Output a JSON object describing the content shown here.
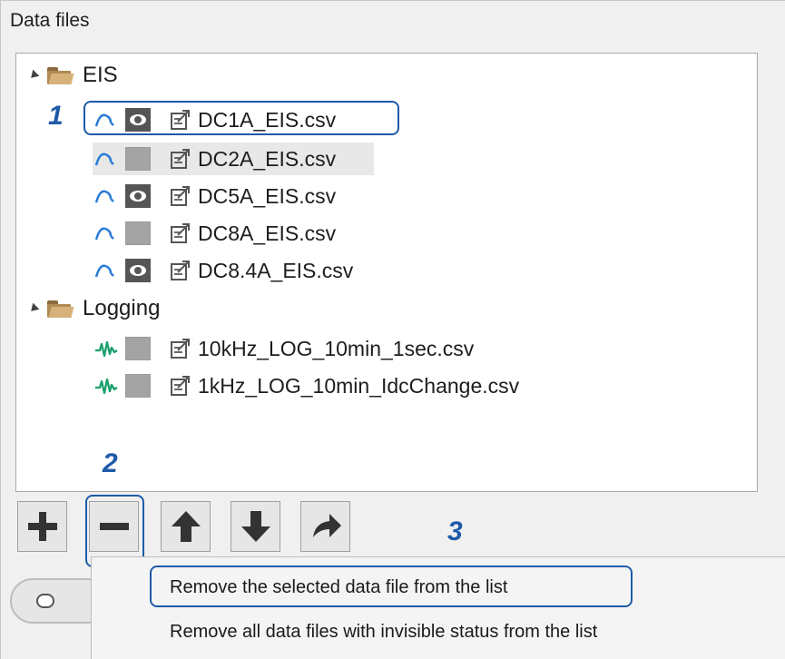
{
  "panel": {
    "title": "Data files"
  },
  "tree": {
    "groups": [
      {
        "label": "EIS",
        "files": [
          {
            "label": "DC1A_EIS.csv",
            "type": "eis",
            "visible": true
          },
          {
            "label": "DC2A_EIS.csv",
            "type": "eis",
            "visible": false
          },
          {
            "label": "DC5A_EIS.csv",
            "type": "eis",
            "visible": true
          },
          {
            "label": "DC8A_EIS.csv",
            "type": "eis",
            "visible": false
          },
          {
            "label": "DC8.4A_EIS.csv",
            "type": "eis",
            "visible": true
          }
        ]
      },
      {
        "label": "Logging",
        "files": [
          {
            "label": "10kHz_LOG_10min_1sec.csv",
            "type": "logging",
            "visible": false
          },
          {
            "label": "1kHz_LOG_10min_IdcChange.csv",
            "type": "logging",
            "visible": false
          }
        ]
      }
    ]
  },
  "toolbar": {
    "buttons": [
      {
        "icon": "plus-icon"
      },
      {
        "icon": "minus-icon"
      },
      {
        "icon": "arrow-up-icon"
      },
      {
        "icon": "arrow-down-icon"
      },
      {
        "icon": "arrow-right-icon"
      }
    ]
  },
  "context_menu": {
    "items": [
      "Remove the selected data file from the list",
      "Remove all data files with invisible status from the list"
    ]
  },
  "annotations": {
    "step1": "1",
    "step2": "2",
    "step3": "3"
  },
  "colors": {
    "annotation": "#1e5ba8",
    "eis_icon": "#2a7bd6",
    "logging_icon": "#1aa06b"
  }
}
